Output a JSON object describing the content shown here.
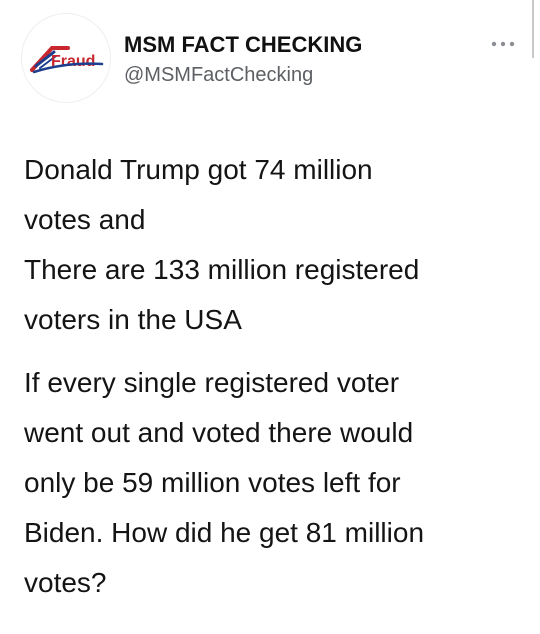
{
  "author": {
    "avatar_logo_text": "Fraud",
    "display_name": "MSM FACT CHECKING",
    "handle": "@MSMFactChecking"
  },
  "tweet": {
    "line_1": "Donald Trump got 74 million",
    "line_2": "votes and",
    "line_3": "There are 133 million registered",
    "line_4": "voters in the USA",
    "line_5": "If every single registered voter",
    "line_6": "went out and voted there would",
    "line_7": "only be 59 million votes left for",
    "line_8": "Biden. How did he get 81 million",
    "line_9": "votes?"
  },
  "icons": {
    "more": "more-options-icon"
  },
  "colors": {
    "logo_red": "#c8282d",
    "logo_blue": "#1e3f8f",
    "handle_gray": "#5c5f63",
    "text": "#141414"
  }
}
